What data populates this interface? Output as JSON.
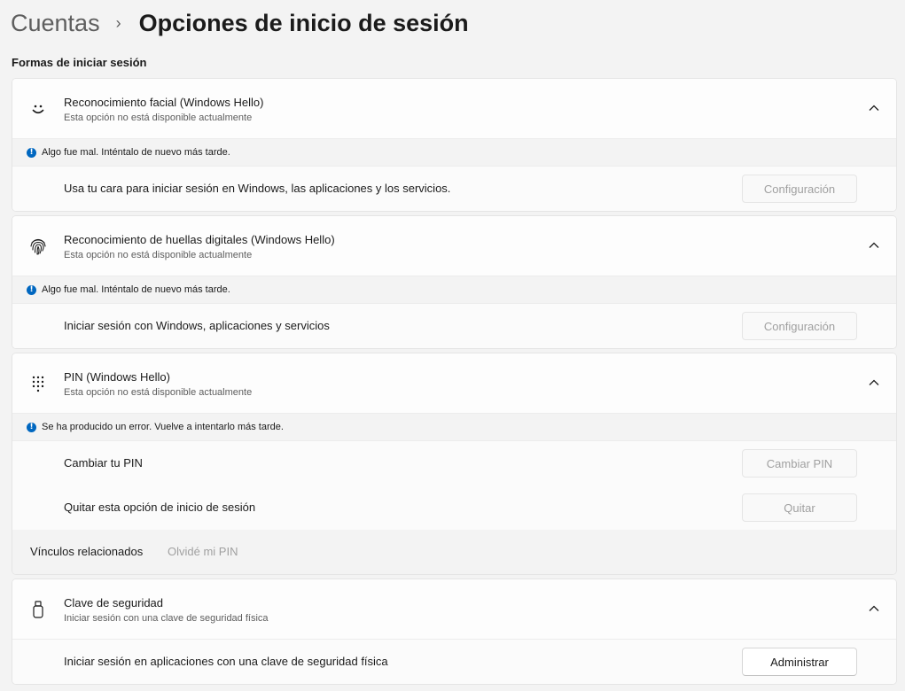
{
  "breadcrumb": {
    "parent": "Cuentas",
    "separator": "›",
    "current": "Opciones de inicio de sesión"
  },
  "section_title": "Formas de iniciar sesión",
  "colors": {
    "accent": "#0067c0",
    "disabled_text": "#a0a0a0"
  },
  "cards": {
    "face": {
      "icon": "smile-face-icon",
      "title": "Reconocimiento facial (Windows Hello)",
      "subtitle": "Esta opción no está disponible actualmente",
      "error": "Algo fue mal. Inténtalo de nuevo más tarde.",
      "row_label": "Usa tu cara para iniciar sesión en Windows, las aplicaciones y los servicios.",
      "button": "Configuración"
    },
    "fingerprint": {
      "icon": "fingerprint-icon",
      "title": "Reconocimiento de huellas digitales (Windows Hello)",
      "subtitle": "Esta opción no está disponible actualmente",
      "error": "Algo fue mal. Inténtalo de nuevo más tarde.",
      "row_label": "Iniciar sesión con Windows, aplicaciones y servicios",
      "button": "Configuración"
    },
    "pin": {
      "icon": "keypad-icon",
      "title": "PIN (Windows Hello)",
      "subtitle": "Esta opción no está disponible actualmente",
      "error": "Se ha producido un error. Vuelve a intentarlo más tarde.",
      "change_label": "Cambiar tu PIN",
      "change_button": "Cambiar PIN",
      "remove_label": "Quitar esta opción de inicio de sesión",
      "remove_button": "Quitar",
      "related_label": "Vínculos relacionados",
      "related_link": "Olvidé mi PIN"
    },
    "security_key": {
      "icon": "usb-key-icon",
      "title": "Clave de seguridad",
      "subtitle": "Iniciar sesión con una clave de seguridad física",
      "row_label": "Iniciar sesión en aplicaciones con una clave de seguridad física",
      "button": "Administrar"
    }
  }
}
